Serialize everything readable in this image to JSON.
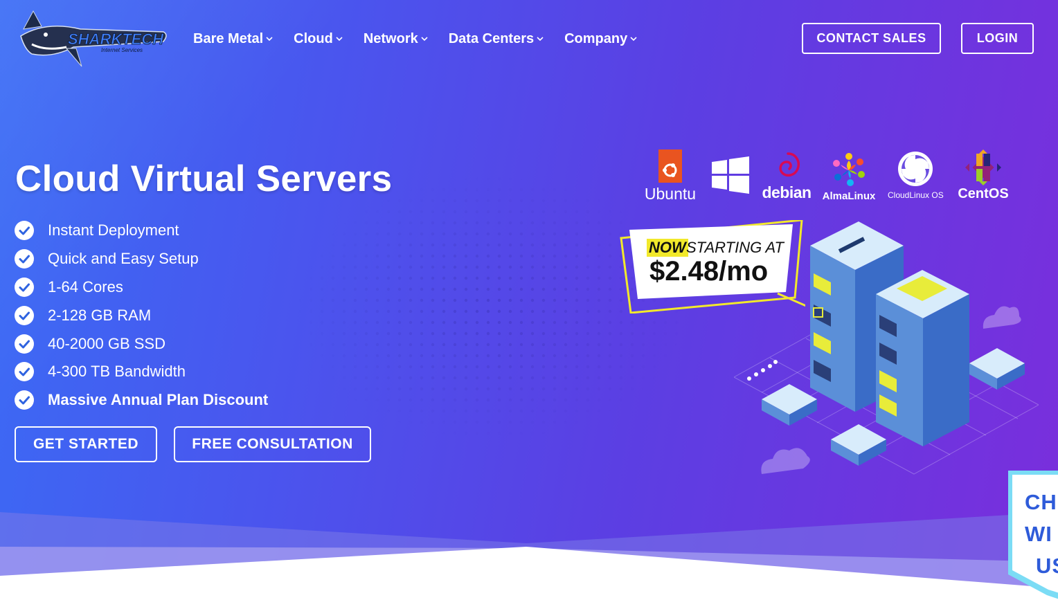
{
  "brand": {
    "name": "SHARKTECH",
    "tagline": "Internet Services"
  },
  "nav": {
    "items": [
      {
        "label": "Bare Metal"
      },
      {
        "label": "Cloud"
      },
      {
        "label": "Network"
      },
      {
        "label": "Data Centers"
      },
      {
        "label": "Company"
      }
    ],
    "contact_label": "CONTACT SALES",
    "login_label": "LOGIN"
  },
  "hero": {
    "title": "Cloud Virtual Servers",
    "features": [
      "Instant Deployment",
      "Quick and Easy Setup",
      "1-64 Cores",
      "2-128 GB RAM",
      "40-2000 GB SSD",
      "4-300 TB Bandwidth",
      "Massive Annual Plan Discount"
    ],
    "primary_cta": "GET STARTED",
    "secondary_cta": "FREE CONSULTATION"
  },
  "os_logos": {
    "ubuntu": "Ubuntu",
    "windows": "windows-logo",
    "debian": "debian",
    "almalinux": "AlmaLinux",
    "cloudlinux": "CloudLinux OS",
    "centos": "CentOS"
  },
  "promo": {
    "now": "NOW",
    "starting": "STARTING AT",
    "price": "$2.48/mo"
  },
  "badge": {
    "lines": [
      "CH",
      "WI",
      "US"
    ]
  },
  "colors": {
    "gradient_start": "#3a6cf5",
    "gradient_end": "#7a2edc",
    "accent_yellow": "#f2e92b",
    "check_blue": "#2f63e0",
    "ubuntu_orange": "#e95420",
    "debian_red": "#d70a53"
  }
}
